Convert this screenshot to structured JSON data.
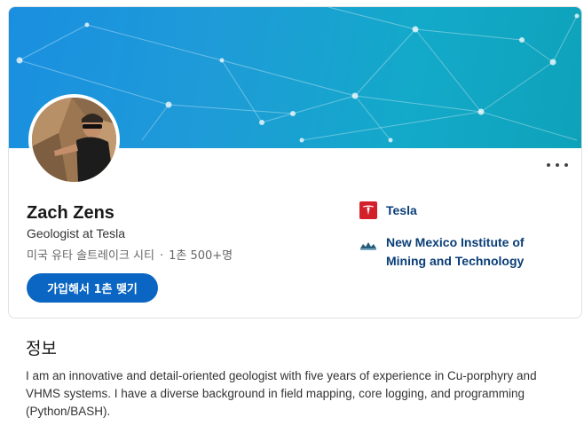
{
  "profile": {
    "name": "Zach Zens",
    "headline": "Geologist at Tesla",
    "location": "미국 유타 솔트레이크 시티",
    "separator": "·",
    "connections": "1촌 500+명",
    "connect_label": "가입해서 1촌 맺기"
  },
  "experience": {
    "company": "Tesla",
    "school": "New Mexico Institute of Mining and Technology"
  },
  "about": {
    "heading": "정보",
    "text": "I am an innovative and detail-oriented geologist with five years of experience in Cu-porphyry and VHMS systems. I have a diverse background in field mapping, core logging, and programming (Python/BASH)."
  },
  "colors": {
    "primary": "#0a66c2",
    "link": "#0a3e78",
    "tesla": "#d3202b",
    "banner_start": "#1a8fe0",
    "banner_end": "#0ea2ba"
  },
  "icons": {
    "more": "more-horizontal-icon",
    "company": "tesla-logo-icon",
    "school": "school-logo-icon"
  }
}
